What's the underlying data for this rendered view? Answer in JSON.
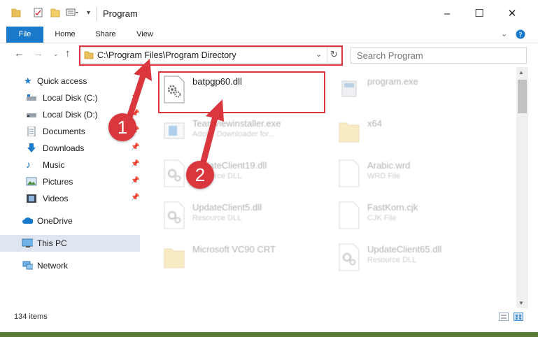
{
  "window": {
    "title": "Program"
  },
  "ribbon": {
    "tabs": [
      "File",
      "Home",
      "Share",
      "View"
    ]
  },
  "navigation": {
    "address": "C:\\Program Files\\Program Directory",
    "search_placeholder": "Search Program"
  },
  "sidebar": {
    "items": [
      {
        "label": "Quick access",
        "icon": "star-icon",
        "pinned": false
      },
      {
        "label": "Local Disk (C:)",
        "icon": "drive-icon",
        "pinned": true
      },
      {
        "label": "Local Disk (D:)",
        "icon": "drive-icon",
        "pinned": true
      },
      {
        "label": "Documents",
        "icon": "documents-icon",
        "pinned": true
      },
      {
        "label": "Downloads",
        "icon": "download-icon",
        "pinned": true
      },
      {
        "label": "Music",
        "icon": "music-icon",
        "pinned": true
      },
      {
        "label": "Pictures",
        "icon": "pictures-icon",
        "pinned": true
      },
      {
        "label": "Videos",
        "icon": "videos-icon",
        "pinned": true
      },
      {
        "label": "OneDrive",
        "icon": "cloud-icon",
        "pinned": false
      },
      {
        "label": "This PC",
        "icon": "computer-icon",
        "pinned": false,
        "selected": true
      },
      {
        "label": "Network",
        "icon": "network-icon",
        "pinned": false
      }
    ]
  },
  "files": [
    {
      "name": "batpgp60.dll",
      "type": "",
      "icon": "dll-gear-icon",
      "highlighted": true
    },
    {
      "name": "program.exe",
      "type": "",
      "icon": "exe-icon"
    },
    {
      "name": "Teamviewinstaller.exe",
      "type": "Adobe Downloader for...",
      "icon": "installer-icon"
    },
    {
      "name": "x64",
      "type": "",
      "icon": "folder-icon"
    },
    {
      "name": "UpdateClient19.dll",
      "type": "Resource DLL",
      "icon": "dll-gear-icon"
    },
    {
      "name": "Arabic.wrd",
      "type": "WRD File",
      "icon": "blank-file-icon"
    },
    {
      "name": "UpdateClient5.dll",
      "type": "Resource DLL",
      "icon": "dll-gear-icon"
    },
    {
      "name": "FastKorn.cjk",
      "type": "CJK File",
      "icon": "blank-file-icon"
    },
    {
      "name": "Microsoft VC90 CRT",
      "type": "",
      "icon": "folder-icon"
    },
    {
      "name": "UpdateClient65.dll",
      "type": "Resource DLL",
      "icon": "dll-gear-icon"
    }
  ],
  "status": {
    "item_count": "134 items"
  },
  "annotations": {
    "step1": "1",
    "step2": "2"
  },
  "colors": {
    "accent": "#1979ca",
    "annotation": "#d9363e",
    "selection": "#dfe6ef"
  }
}
